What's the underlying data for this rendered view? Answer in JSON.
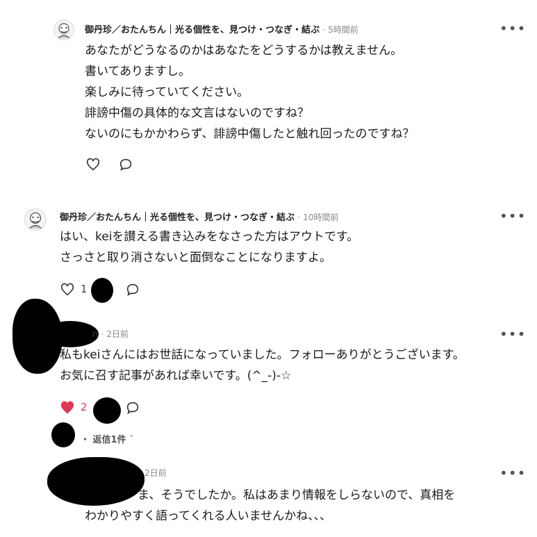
{
  "comments": [
    {
      "author": "御丹珍／おたんちん｜光る個性を、見つけ・つなぎ・結ぶ",
      "time": "5時間前",
      "lines": [
        "あなたがどうなるのかはあなたをどうするかは教えません。",
        "書いてありますし。",
        "楽しみに待っていてください。",
        "誹謗中傷の具体的な文言はないのですね？",
        "ないのにもかかわらず、誹謗中傷したと触れ回ったのですね？"
      ]
    },
    {
      "author": "御丹珍／おたんちん｜光る個性を、見つけ・つなぎ・結ぶ",
      "time": "10時間前",
      "lines": [
        "はい、keiを讃える書き込みをなさった方はアウトです。",
        "さっさと取り消さないと面倒なことになりますよ。"
      ],
      "like_count": "1"
    },
    {
      "author_fragment": "n",
      "time": "2日前",
      "lines": [
        "私もkeiさんにはお世話になっていました。フォローありがとうございます。",
        "お気に召す記事があれば幸いです。(^_-)-☆"
      ],
      "like_count": "2",
      "replies_label": "返信1件",
      "replies_sep": "・"
    },
    {
      "time": "2日前",
      "lines": [
        "ま、そうでしたか。私はあまり情報をしらないので、真相を",
        "わかりやすく語ってくれる人いませんかね、、、"
      ]
    }
  ],
  "more_label": "•••",
  "colors": {
    "liked_heart": "#d93a55",
    "text": "#1a1a1a",
    "muted": "#888888"
  }
}
